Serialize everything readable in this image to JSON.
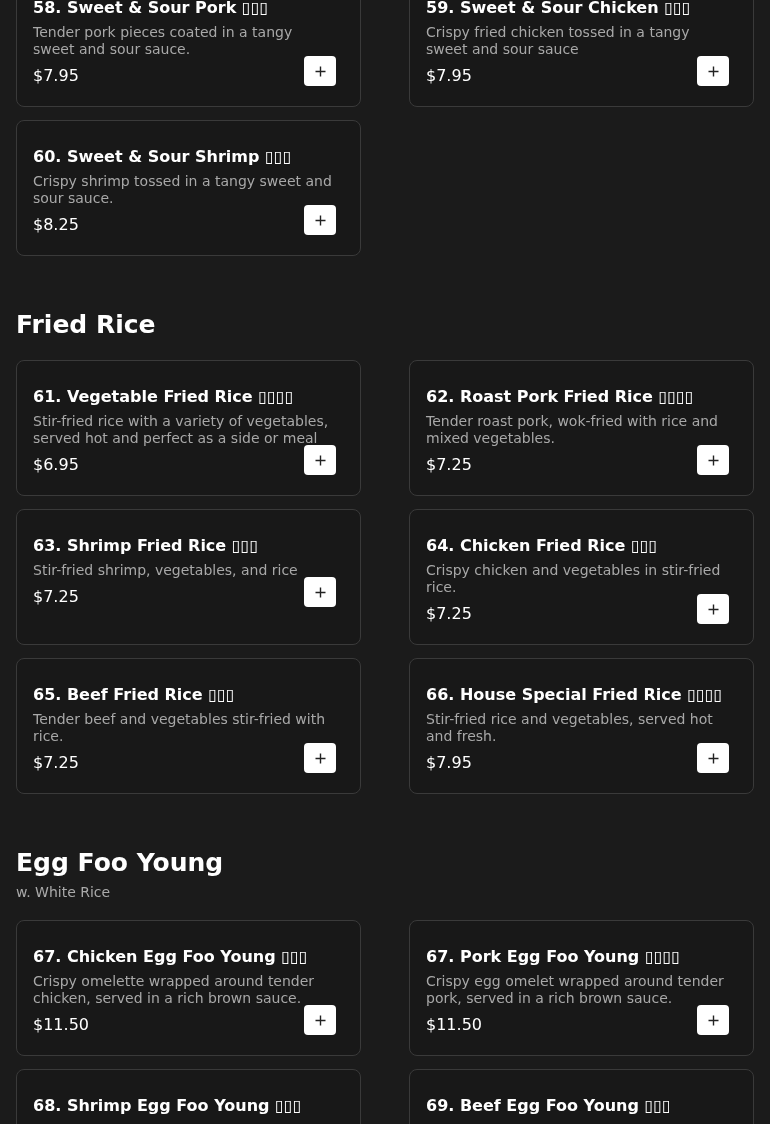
{
  "sections": [
    {
      "items": [
        {
          "title": "58. Sweet & Sour Pork ▯▯▯",
          "description": "Tender pork pieces coated in a tangy sweet and sour sauce.",
          "price": "$7.95"
        },
        {
          "title": "59. Sweet & Sour Chicken ▯▯▯",
          "description": "Crispy fried chicken tossed in a tangy sweet and sour sauce",
          "price": "$7.95"
        },
        {
          "title": "60. Sweet & Sour Shrimp ▯▯▯",
          "description": "Crispy shrimp tossed in a tangy sweet and sour sauce.",
          "price": "$8.25"
        }
      ]
    },
    {
      "title": "Fried Rice",
      "items": [
        {
          "title": "61. Vegetable Fried Rice ▯▯▯▯",
          "description": "Stir-fried rice with a variety of vegetables, served hot and perfect as a side or meal",
          "price": "$6.95"
        },
        {
          "title": "62. Roast Pork Fried Rice ▯▯▯▯",
          "description": "Tender roast pork, wok-fried with rice and mixed vegetables.",
          "price": "$7.25"
        },
        {
          "title": "63. Shrimp Fried Rice ▯▯▯",
          "description": "Stir-fried shrimp, vegetables, and rice",
          "price": "$7.25"
        },
        {
          "title": "64. Chicken Fried Rice ▯▯▯",
          "description": "Crispy chicken and vegetables in stir-fried rice.",
          "price": "$7.25"
        },
        {
          "title": "65. Beef Fried Rice ▯▯▯",
          "description": "Tender beef and vegetables stir-fried with rice.",
          "price": "$7.25"
        },
        {
          "title": "66. House Special Fried Rice ▯▯▯▯",
          "description": "Stir-fried rice and vegetables, served hot and fresh.",
          "price": "$7.95"
        }
      ]
    },
    {
      "title": "Egg Foo Young",
      "subtitle": "w. White Rice",
      "items": [
        {
          "title": "67. Chicken Egg Foo Young ▯▯▯",
          "description": "Crispy omelette wrapped around tender chicken, served in a rich brown sauce.",
          "price": "$11.50"
        },
        {
          "title": "67. Pork Egg Foo Young ▯▯▯▯",
          "description": "Crispy egg omelet wrapped around tender pork, served in a rich brown sauce.",
          "price": "$11.50"
        },
        {
          "title": "68. Shrimp Egg Foo Young ▯▯▯"
        },
        {
          "title": "69. Beef Egg Foo Young ▯▯▯"
        }
      ]
    }
  ]
}
